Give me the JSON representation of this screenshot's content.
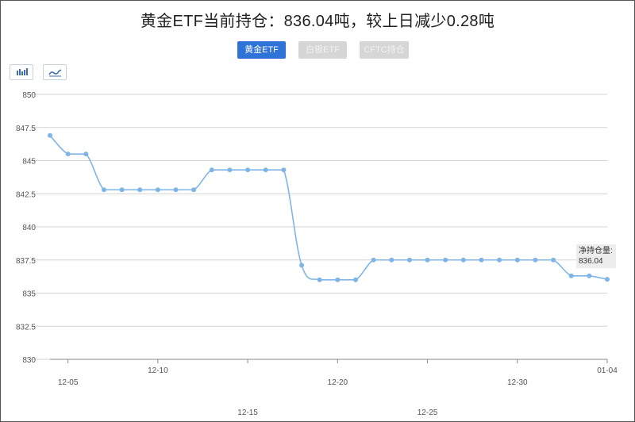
{
  "title": "黄金ETF当前持仓：836.04吨，较上日减少0.28吨",
  "tabs": [
    {
      "label": "黄金ETF",
      "active": true
    },
    {
      "label": "白银ETF",
      "active": false
    },
    {
      "label": "CFTC持仓",
      "active": false
    }
  ],
  "toolbar": {
    "bar_icon": "bar-chart-icon",
    "line_icon": "line-chart-icon"
  },
  "tooltip": {
    "label": "净持仓量:",
    "value": "836.04"
  },
  "colors": {
    "line": "#7fb5e6",
    "grid": "#d3d3d3",
    "tab_active": "#2f72d8",
    "tab_inactive": "#d6d6d6"
  },
  "chart_data": {
    "type": "line",
    "title": "",
    "xlabel": "",
    "ylabel": "",
    "ylim": [
      830,
      850
    ],
    "yticks": [
      830,
      832.5,
      835,
      837.5,
      840,
      842.5,
      845,
      847.5,
      850
    ],
    "ytick_labels": [
      "830",
      "832.5",
      "835",
      "837.5",
      "840",
      "842.5",
      "845",
      "847.5",
      "850"
    ],
    "grid": true,
    "x": [
      "12-04",
      "12-05",
      "12-06",
      "12-07",
      "12-08",
      "12-09",
      "12-10",
      "12-11",
      "12-12",
      "12-13",
      "12-14",
      "12-15",
      "12-16",
      "12-17",
      "12-18",
      "12-19",
      "12-20",
      "12-21",
      "12-22",
      "12-23",
      "12-24",
      "12-25",
      "12-26",
      "12-27",
      "12-28",
      "12-29",
      "12-30",
      "12-31",
      "01-01",
      "01-02",
      "01-03",
      "01-04"
    ],
    "xticks": [
      {
        "label": "12-05",
        "index": 1,
        "row": 1
      },
      {
        "label": "12-10",
        "index": 6,
        "row": 0
      },
      {
        "label": "12-15",
        "index": 11,
        "row": 2
      },
      {
        "label": "12-20",
        "index": 16,
        "row": 1
      },
      {
        "label": "12-25",
        "index": 21,
        "row": 2
      },
      {
        "label": "12-30",
        "index": 26,
        "row": 1
      },
      {
        "label": "01-04",
        "index": 31,
        "row": 0
      }
    ],
    "series": [
      {
        "values": [
          846.9,
          845.5,
          845.5,
          842.8,
          842.8,
          842.8,
          842.8,
          842.8,
          842.8,
          844.3,
          844.3,
          844.3,
          844.3,
          844.3,
          837.1,
          836.0,
          836.0,
          836.0,
          837.5,
          837.5,
          837.5,
          837.5,
          837.5,
          837.5,
          837.5,
          837.5,
          837.5,
          837.5,
          837.5,
          836.3,
          836.3,
          836.04
        ]
      }
    ]
  }
}
